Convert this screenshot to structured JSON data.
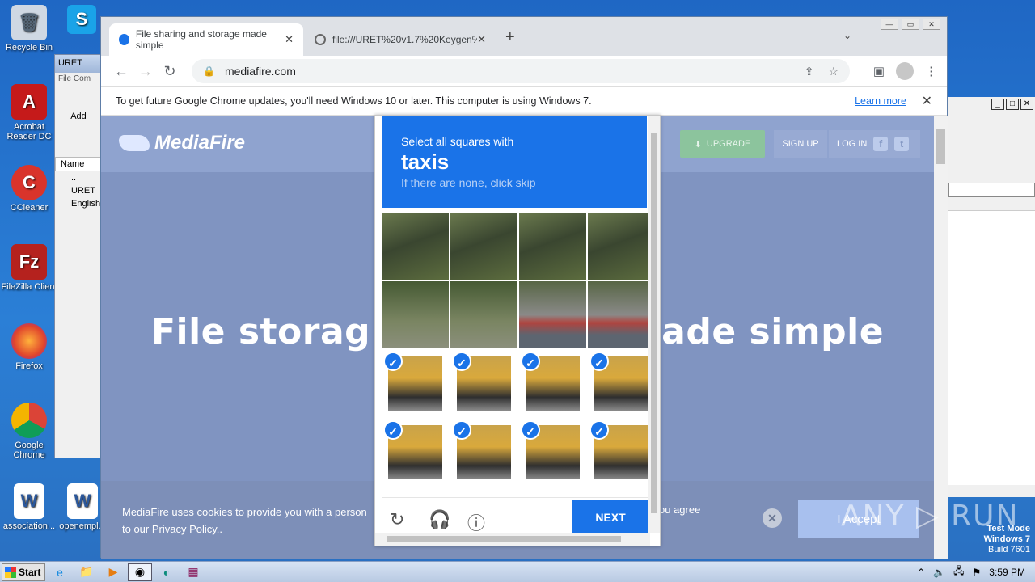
{
  "desktop": {
    "icons": [
      {
        "label": "Recycle Bin",
        "icon": "recycle-bin-icon"
      },
      {
        "label": "Acrobat Reader DC",
        "icon": "acrobat-icon"
      },
      {
        "label": "CCleaner",
        "icon": "ccleaner-icon"
      },
      {
        "label": "FileZilla Client",
        "icon": "filezilla-icon"
      },
      {
        "label": "Firefox",
        "icon": "firefox-icon"
      },
      {
        "label": "Google Chrome",
        "icon": "chrome-icon"
      },
      {
        "label": "association...",
        "icon": "word-doc-icon"
      },
      {
        "label": "openempl...",
        "icon": "word-doc-icon"
      },
      {
        "label": "Skype",
        "icon": "skype-icon"
      }
    ]
  },
  "bg_window": {
    "title": "URET",
    "menu_file": "File",
    "menu_com": "Com",
    "add_label": "Add",
    "col_name": "Name",
    "rows": [
      "..",
      "URET",
      "English"
    ]
  },
  "chrome": {
    "tabs": [
      {
        "title": "File sharing and storage made simple",
        "close": "✕"
      },
      {
        "title": "file:///URET%20v1.7%20Keygen%...",
        "close": "✕"
      }
    ],
    "new_tab": "+",
    "url": "mediafire.com",
    "infobar_text": "To get future Google Chrome updates, you'll need Windows 10 or later. This computer is using Windows 7.",
    "infobar_link": "Learn more"
  },
  "page": {
    "logo": "MediaFire",
    "upgrade": "UPGRADE",
    "signup": "SIGN UP",
    "login": "LOG IN",
    "hero_left": "File storag",
    "hero_right": "ade simple",
    "cookie_left": "MediaFire uses cookies to provide you with a person",
    "cookie_left2": "to our Privacy Policy..",
    "cookie_right": "ou agree",
    "accept": "I Accept"
  },
  "captcha": {
    "line1": "Select all squares with",
    "keyword": "taxis",
    "line3": "If there are none, click skip",
    "next": "NEXT",
    "cells": [
      {
        "kind": "tree",
        "checked": false
      },
      {
        "kind": "tree",
        "checked": false
      },
      {
        "kind": "tree",
        "checked": false
      },
      {
        "kind": "tree",
        "checked": false
      },
      {
        "kind": "tree b",
        "checked": false
      },
      {
        "kind": "tree b",
        "checked": false
      },
      {
        "kind": "street",
        "checked": false
      },
      {
        "kind": "street",
        "checked": false
      },
      {
        "kind": "taxi",
        "checked": true
      },
      {
        "kind": "taxi",
        "checked": true
      },
      {
        "kind": "taxi",
        "checked": true
      },
      {
        "kind": "taxi",
        "checked": true
      },
      {
        "kind": "taxi",
        "checked": true
      },
      {
        "kind": "taxi",
        "checked": true
      },
      {
        "kind": "taxi",
        "checked": true
      },
      {
        "kind": "taxi",
        "checked": true
      }
    ]
  },
  "overlay": {
    "watermark": "ANY ▷ RUN",
    "testmode_1": "Test Mode",
    "testmode_2": "Windows 7",
    "testmode_3": "Build 7601"
  },
  "taskbar": {
    "start": "Start",
    "clock": "3:59 PM"
  }
}
